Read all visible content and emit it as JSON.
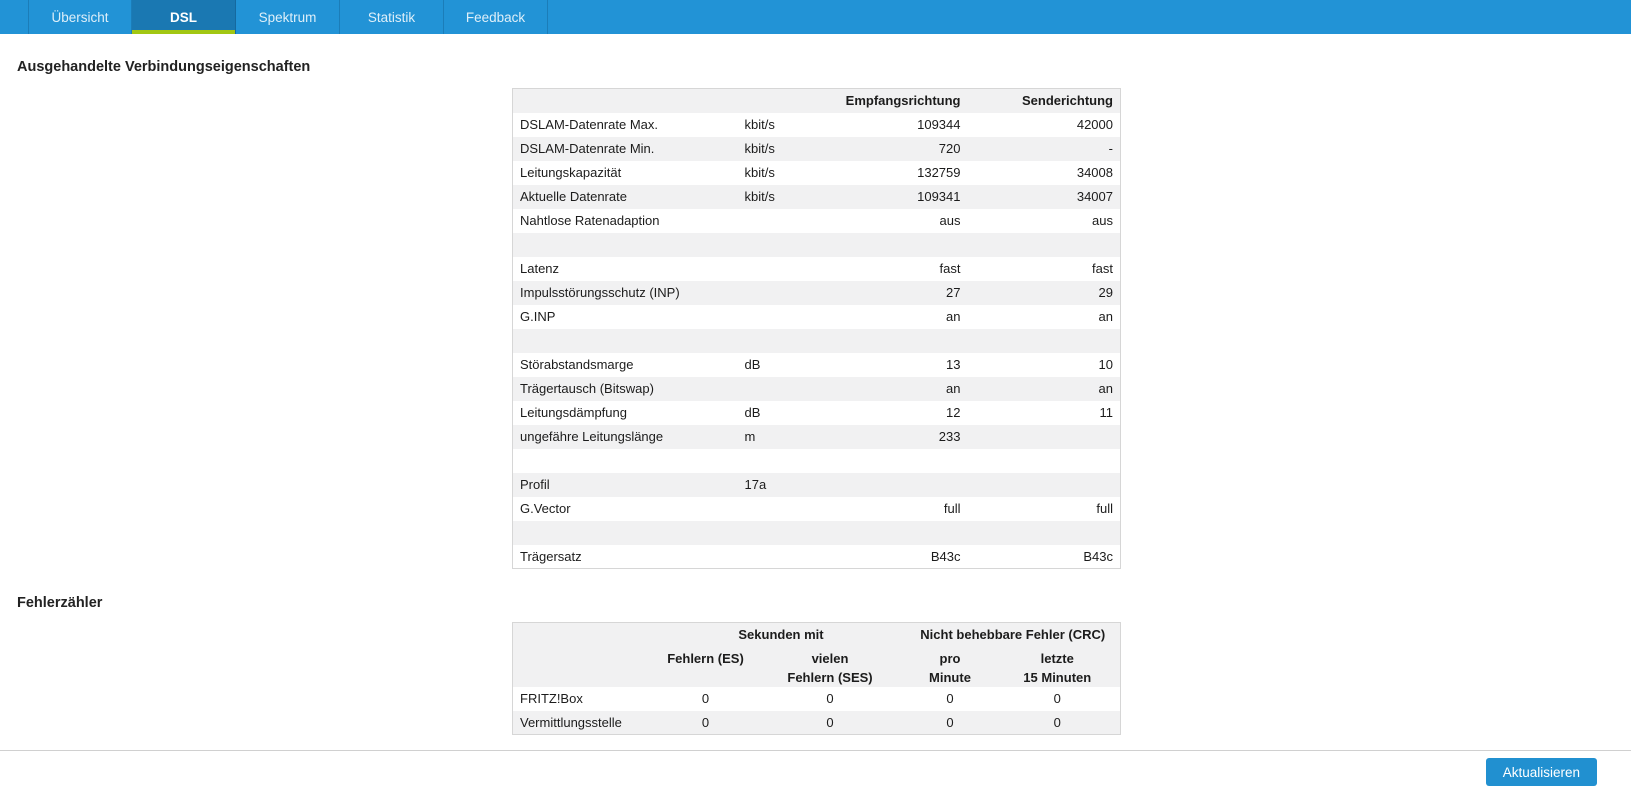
{
  "tabs": [
    {
      "label": "Übersicht",
      "active": false
    },
    {
      "label": "DSL",
      "active": true
    },
    {
      "label": "Spektrum",
      "active": false
    },
    {
      "label": "Statistik",
      "active": false
    },
    {
      "label": "Feedback",
      "active": false
    }
  ],
  "sections": {
    "connection": {
      "title": "Ausgehandelte Verbindungseigenschaften",
      "headers": {
        "rx": "Empfangsrichtung",
        "tx": "Senderichtung"
      },
      "rows": [
        {
          "label": "DSLAM-Datenrate Max.",
          "unit": "kbit/s",
          "rx": "109344",
          "tx": "42000"
        },
        {
          "label": "DSLAM-Datenrate Min.",
          "unit": "kbit/s",
          "rx": "720",
          "tx": "-"
        },
        {
          "label": "Leitungskapazität",
          "unit": "kbit/s",
          "rx": "132759",
          "tx": "34008"
        },
        {
          "label": "Aktuelle Datenrate",
          "unit": "kbit/s",
          "rx": "109341",
          "tx": "34007"
        },
        {
          "label": "Nahtlose Ratenadaption",
          "unit": "",
          "rx": "aus",
          "tx": "aus"
        },
        {
          "label": "",
          "unit": "",
          "rx": "",
          "tx": ""
        },
        {
          "label": "Latenz",
          "unit": "",
          "rx": "fast",
          "tx": "fast"
        },
        {
          "label": "Impulsstörungsschutz (INP)",
          "unit": "",
          "rx": "27",
          "tx": "29"
        },
        {
          "label": "G.INP",
          "unit": "",
          "rx": "an",
          "tx": "an"
        },
        {
          "label": "",
          "unit": "",
          "rx": "",
          "tx": ""
        },
        {
          "label": "Störabstandsmarge",
          "unit": "dB",
          "rx": "13",
          "tx": "10"
        },
        {
          "label": "Trägertausch (Bitswap)",
          "unit": "",
          "rx": "an",
          "tx": "an"
        },
        {
          "label": "Leitungsdämpfung",
          "unit": "dB",
          "rx": "12",
          "tx": "11"
        },
        {
          "label": "ungefähre Leitungslänge",
          "unit": "m",
          "rx": "233",
          "tx": ""
        },
        {
          "label": "",
          "unit": "",
          "rx": "",
          "tx": ""
        },
        {
          "label": "Profil",
          "unit": "17a",
          "rx": "",
          "tx": ""
        },
        {
          "label": "G.Vector",
          "unit": "",
          "rx": "full",
          "tx": "full"
        },
        {
          "label": "",
          "unit": "",
          "rx": "",
          "tx": ""
        },
        {
          "label": "Trägersatz",
          "unit": "",
          "rx": "B43c",
          "tx": "B43c"
        }
      ]
    },
    "errors": {
      "title": "Fehlerzähler",
      "group_headers": [
        "Sekunden mit",
        "Nicht behebbare Fehler (CRC)"
      ],
      "col_headers": [
        "Fehlern (ES)",
        "vielen\nFehlern (SES)",
        "pro\nMinute",
        "letzte\n15 Minuten"
      ],
      "rows": [
        {
          "label": "FRITZ!Box",
          "values": [
            "0",
            "0",
            "0",
            "0"
          ]
        },
        {
          "label": "Vermittlungsstelle",
          "values": [
            "0",
            "0",
            "0",
            "0"
          ]
        }
      ]
    }
  },
  "footer": {
    "refresh_label": "Aktualisieren"
  },
  "colors": {
    "tabbar": "#2293d6",
    "tab_active": "#1a78b2",
    "accent_green": "#a2c712",
    "button_blue": "#2190d0",
    "row_stripe": "#f1f1f2"
  }
}
